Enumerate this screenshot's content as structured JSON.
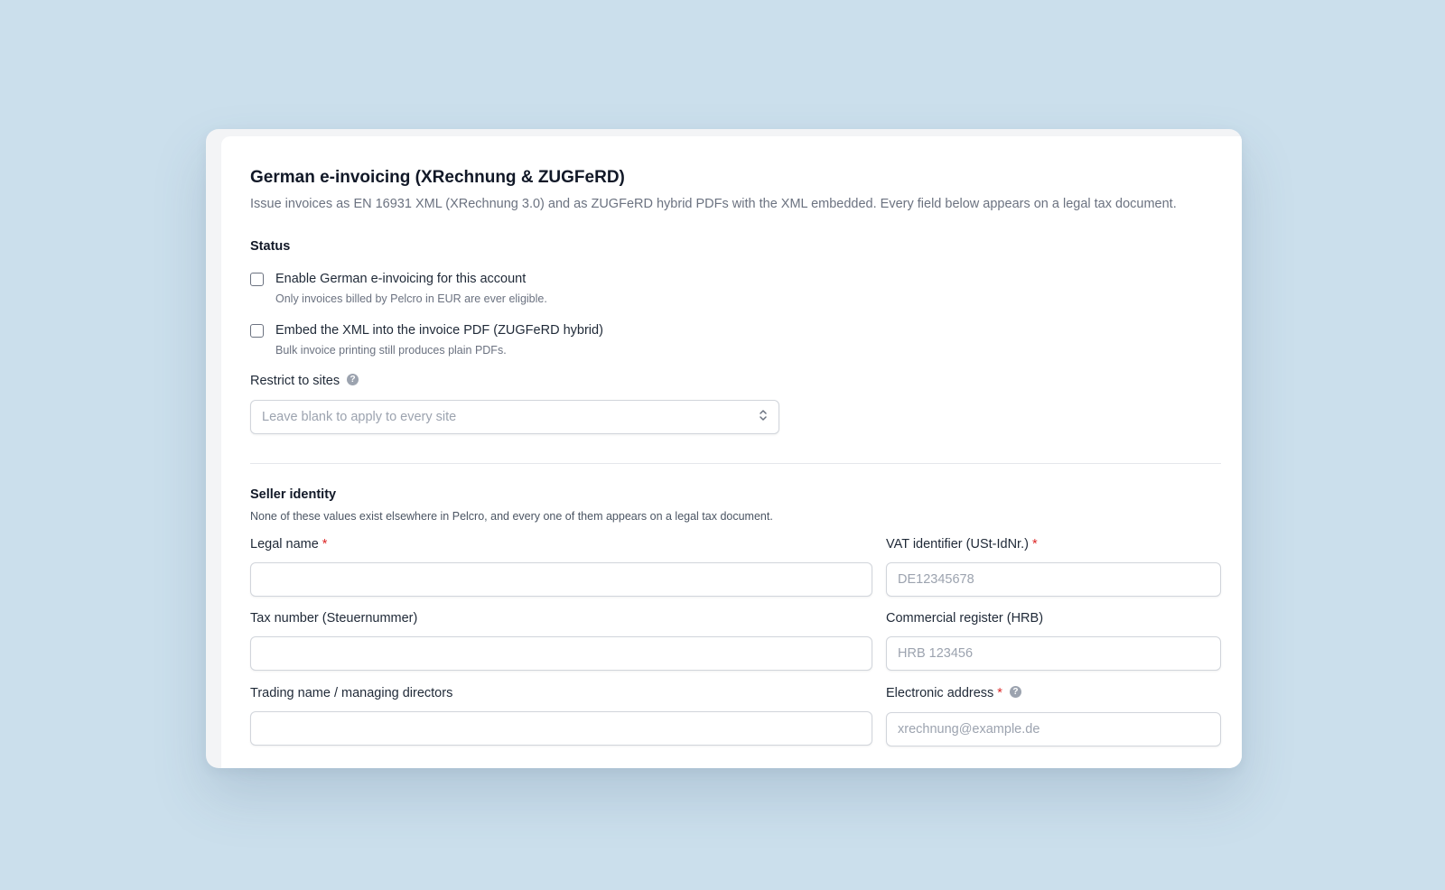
{
  "header": {
    "title": "German e-invoicing (XRechnung & ZUGFeRD)",
    "description": "Issue invoices as EN 16931 XML (XRechnung 3.0) and as ZUGFeRD hybrid PDFs with the XML embedded. Every field below appears on a legal tax document."
  },
  "status": {
    "heading": "Status",
    "options": [
      {
        "label": "Enable German e-invoicing for this account",
        "help": "Only invoices billed by Pelcro in EUR are ever eligible.",
        "checked": false
      },
      {
        "label": "Embed the XML into the invoice PDF (ZUGFeRD hybrid)",
        "help": "Bulk invoice printing still produces plain PDFs.",
        "checked": false
      }
    ],
    "restrict": {
      "label": "Restrict to sites",
      "placeholder": "Leave blank to apply to every site"
    }
  },
  "seller": {
    "heading": "Seller identity",
    "help": "None of these values exist elsewhere in Pelcro, and every one of them appears on a legal tax document.",
    "required_mark": "*",
    "fields": {
      "legal_name": {
        "label": "Legal name",
        "value": "",
        "placeholder": ""
      },
      "vat_id": {
        "label": "VAT identifier (USt-IdNr.)",
        "value": "",
        "placeholder": "DE12345678"
      },
      "tax_number": {
        "label": "Tax number (Steuernummer)",
        "value": "",
        "placeholder": ""
      },
      "commercial_register": {
        "label": "Commercial register (HRB)",
        "value": "",
        "placeholder": "HRB 123456"
      },
      "trading_name": {
        "label": "Trading name / managing directors",
        "value": "",
        "placeholder": ""
      },
      "electronic_address": {
        "label": "Electronic address",
        "value": "",
        "placeholder": "xrechnung@example.de"
      }
    }
  },
  "icons": {
    "help": "question-circle-icon",
    "select_arrows": "chevron-up-down-icon"
  },
  "colors": {
    "background": "#cbdfec",
    "required": "#dc2626",
    "text": "#1f2937",
    "muted": "#6b7280"
  }
}
